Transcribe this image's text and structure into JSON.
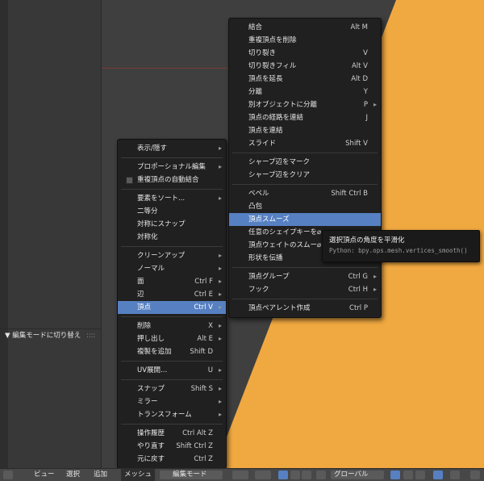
{
  "left_panel": {
    "operator_header": "▼ 編集モードに切り替え",
    "dots": "::::"
  },
  "colors": {
    "mesh": "#f0a841",
    "highlight": "#5680c2",
    "menu_bg": "#202020"
  },
  "menu_main": [
    {
      "type": "item",
      "label": "表示/隠す",
      "arrow": true
    },
    {
      "type": "sep"
    },
    {
      "type": "item",
      "label": "プロポーショナル編集",
      "arrow": true
    },
    {
      "type": "item",
      "label": "重複頂点の自動結合",
      "checkbox": true
    },
    {
      "type": "sep"
    },
    {
      "type": "item",
      "label": "要素をソート...",
      "arrow": true
    },
    {
      "type": "item",
      "label": "二等分"
    },
    {
      "type": "item",
      "label": "対称にスナップ"
    },
    {
      "type": "item",
      "label": "対称化"
    },
    {
      "type": "sep"
    },
    {
      "type": "item",
      "label": "クリーンアップ",
      "arrow": true
    },
    {
      "type": "item",
      "label": "ノーマル",
      "arrow": true
    },
    {
      "type": "item",
      "label": "面",
      "shortcut": "Ctrl F",
      "arrow": true
    },
    {
      "type": "item",
      "label": "辺",
      "shortcut": "Ctrl E",
      "arrow": true
    },
    {
      "type": "item",
      "label": "頂点",
      "shortcut": "Ctrl V",
      "arrow": true,
      "highlight": true
    },
    {
      "type": "sep"
    },
    {
      "type": "item",
      "label": "削除",
      "shortcut": "X",
      "arrow": true
    },
    {
      "type": "item",
      "label": "押し出し",
      "shortcut": "Alt E",
      "arrow": true
    },
    {
      "type": "item",
      "label": "複製を追加",
      "shortcut": "Shift D"
    },
    {
      "type": "sep"
    },
    {
      "type": "item",
      "label": "UV展開...",
      "shortcut": "U",
      "arrow": true
    },
    {
      "type": "sep"
    },
    {
      "type": "item",
      "label": "スナップ",
      "shortcut": "Shift S",
      "arrow": true
    },
    {
      "type": "item",
      "label": "ミラー",
      "arrow": true
    },
    {
      "type": "item",
      "label": "トランスフォーム",
      "arrow": true
    },
    {
      "type": "sep"
    },
    {
      "type": "item",
      "label": "操作履歴",
      "shortcut": "Ctrl Alt Z"
    },
    {
      "type": "item",
      "label": "やり直す",
      "shortcut": "Shift Ctrl Z"
    },
    {
      "type": "item",
      "label": "元に戻す",
      "shortcut": "Ctrl Z"
    }
  ],
  "menu_vertex": [
    {
      "type": "item",
      "label": "結合",
      "shortcut": "Alt M"
    },
    {
      "type": "item",
      "label": "重複頂点を削除"
    },
    {
      "type": "item",
      "label": "切り裂き",
      "shortcut": "V"
    },
    {
      "type": "item",
      "label": "切り裂きフィル",
      "shortcut": "Alt V"
    },
    {
      "type": "item",
      "label": "頂点を延長",
      "shortcut": "Alt D"
    },
    {
      "type": "item",
      "label": "分離",
      "shortcut": "Y"
    },
    {
      "type": "item",
      "label": "別オブジェクトに分離",
      "shortcut": "P",
      "arrow": true
    },
    {
      "type": "item",
      "label": "頂点の経路を連結",
      "shortcut": "J"
    },
    {
      "type": "item",
      "label": "頂点を連結"
    },
    {
      "type": "item",
      "label": "スライド",
      "shortcut": "Shift V"
    },
    {
      "type": "sep"
    },
    {
      "type": "item",
      "label": "シャープ辺をマーク"
    },
    {
      "type": "item",
      "label": "シャープ辺をクリア"
    },
    {
      "type": "sep"
    },
    {
      "type": "item",
      "label": "ベベル",
      "shortcut": "Shift Ctrl B"
    },
    {
      "type": "item",
      "label": "凸包"
    },
    {
      "type": "item",
      "label": "頂点スムーズ",
      "highlight": true
    },
    {
      "type": "item",
      "label": "任意のシェイプキーを⌀"
    },
    {
      "type": "item",
      "label": "頂点ウェイトのスムー⌀"
    },
    {
      "type": "item",
      "label": "形状を伝播"
    },
    {
      "type": "sep"
    },
    {
      "type": "item",
      "label": "頂点グループ",
      "shortcut": "Ctrl G",
      "arrow": true
    },
    {
      "type": "item",
      "label": "フック",
      "shortcut": "Ctrl H",
      "arrow": true
    },
    {
      "type": "sep"
    },
    {
      "type": "item",
      "label": "頂点ペアレント作成",
      "shortcut": "Ctrl P"
    }
  ],
  "tooltip": {
    "title": "選択頂点の角度を平滑化",
    "python": "Python: bpy.ops.mesh.vertices_smooth()"
  },
  "statusbar": {
    "view": "ビュー",
    "select": "選択",
    "add": "追加",
    "mesh": "メッシュ",
    "mode": "編集モード",
    "orientation": "グローバル"
  },
  "icons": [
    "editor-type-icon",
    "mode-icon",
    "shading-icon",
    "pivot-icon",
    "manipulator-icon",
    "orientation-icon",
    "proportional-icon",
    "snap-icon",
    "layer-icon"
  ]
}
